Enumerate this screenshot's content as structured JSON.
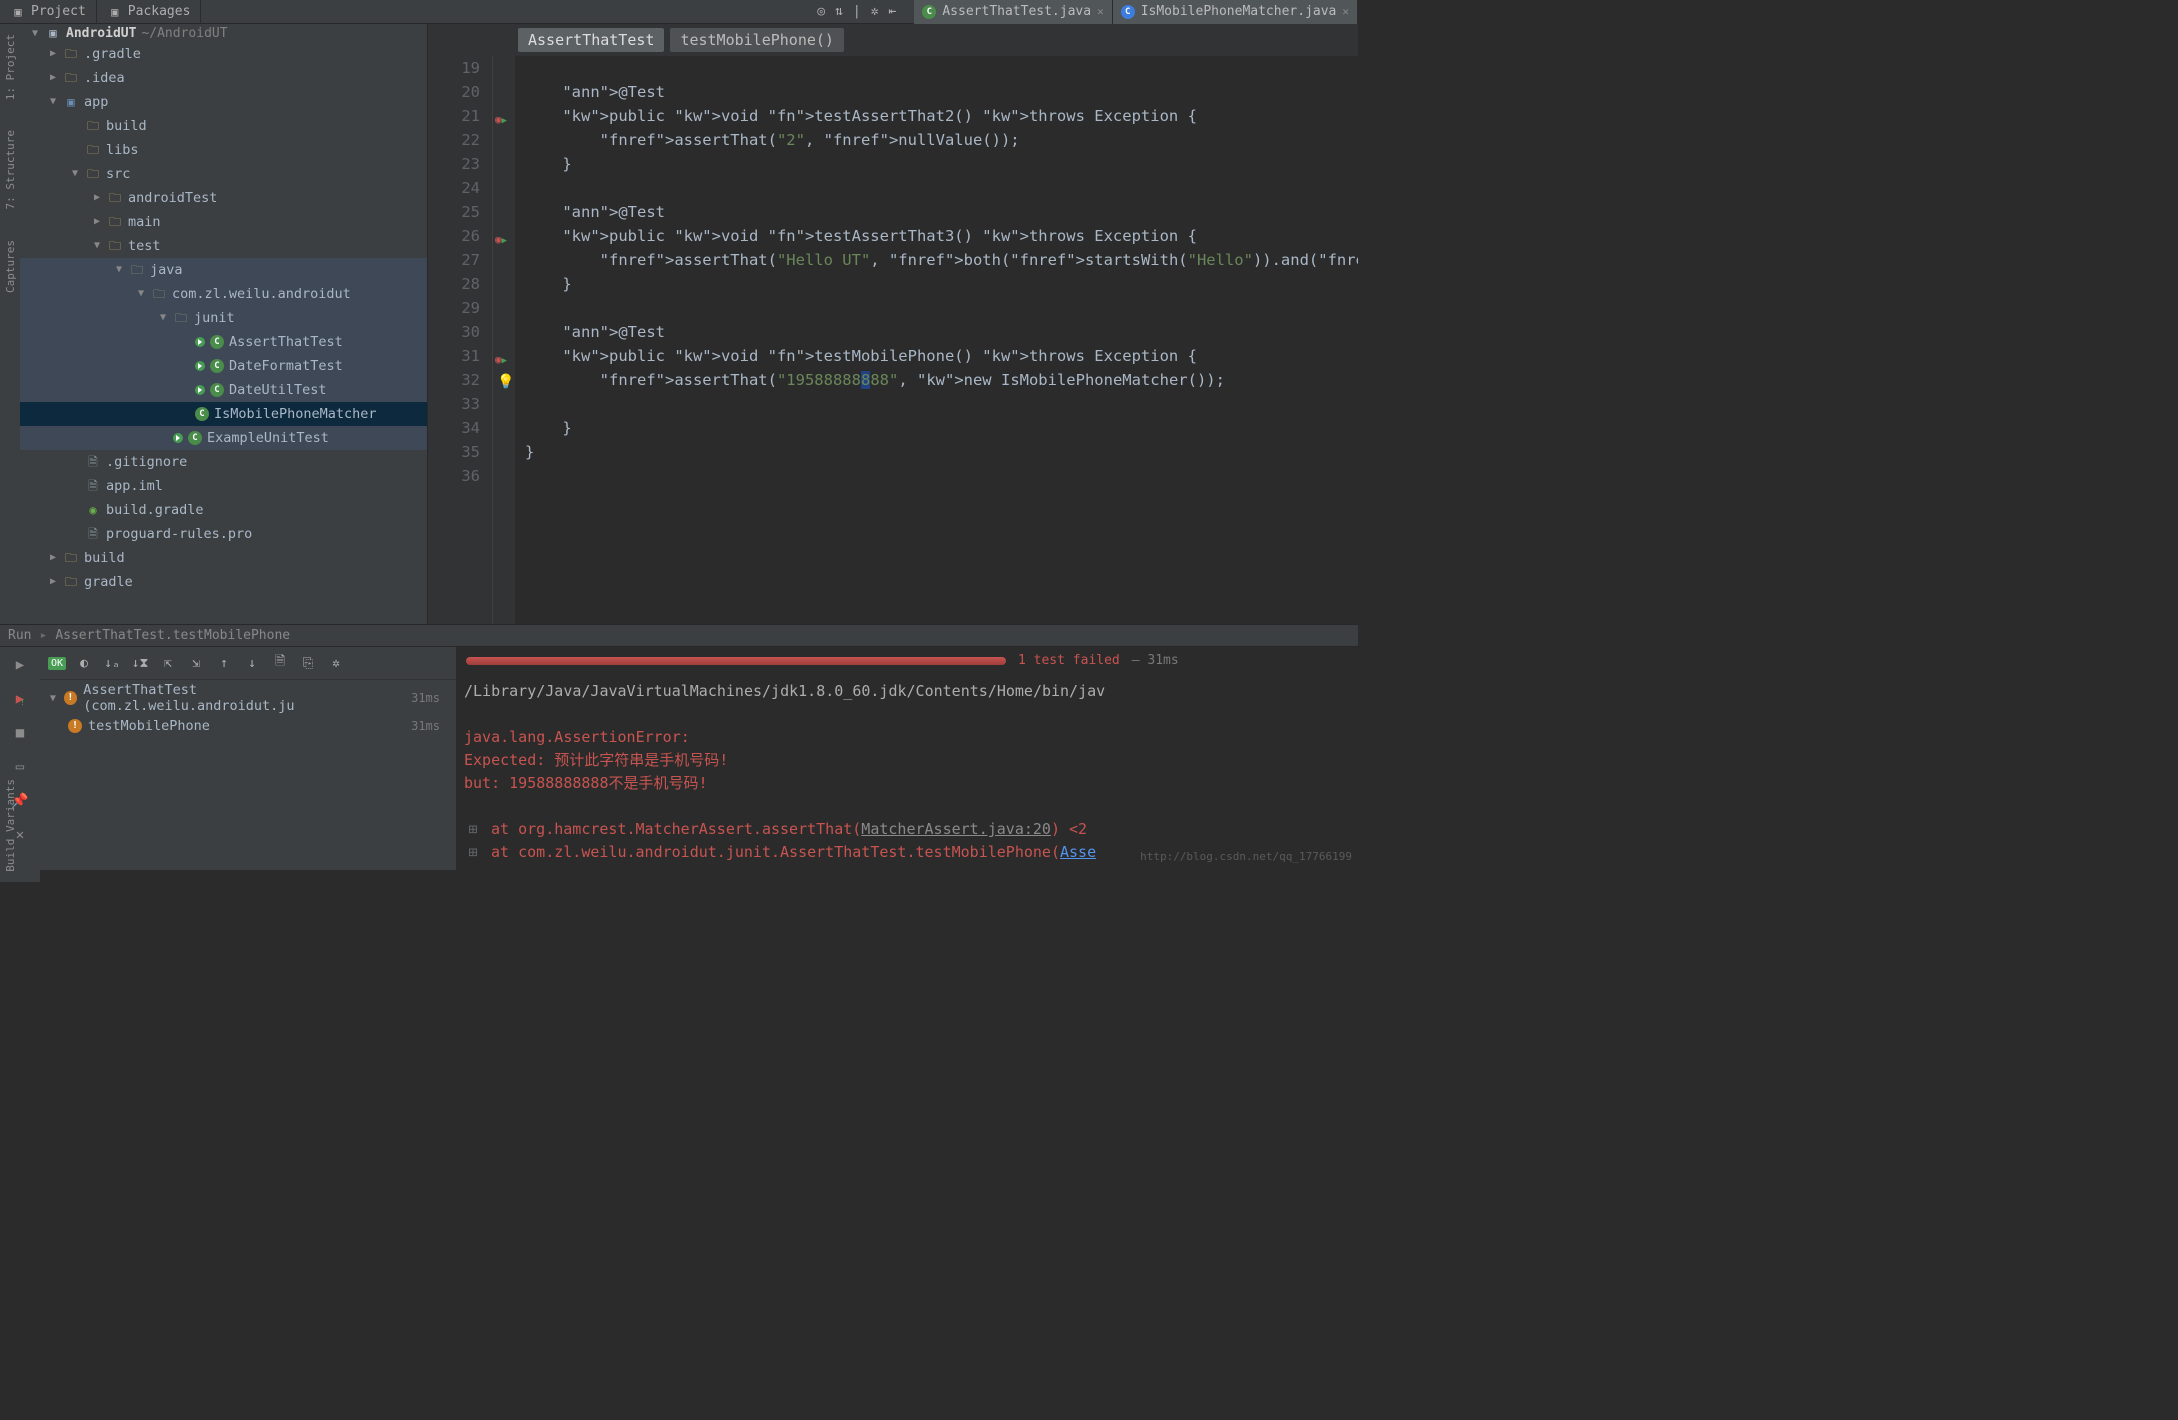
{
  "topbar": {
    "tabs": [
      "Project",
      "Packages"
    ],
    "editorTabs": [
      {
        "name": "AssertThatTest.java"
      },
      {
        "name": "IsMobilePhoneMatcher.java"
      }
    ]
  },
  "leftRail": [
    "1: Project",
    "7: Structure",
    "Captures"
  ],
  "bottomRail": "Build Variants",
  "project": {
    "root": {
      "name": "AndroidUT",
      "path": "~/AndroidUT"
    },
    "tree": [
      {
        "depth": 0,
        "tw": "▶",
        "type": "folder",
        "name": ".gradle"
      },
      {
        "depth": 0,
        "tw": "▶",
        "type": "folder",
        "name": ".idea"
      },
      {
        "depth": 0,
        "tw": "▼",
        "type": "mod",
        "name": "app"
      },
      {
        "depth": 1,
        "tw": "",
        "type": "folder",
        "name": "build"
      },
      {
        "depth": 1,
        "tw": "",
        "type": "folder",
        "name": "libs"
      },
      {
        "depth": 1,
        "tw": "▼",
        "type": "folder",
        "name": "src"
      },
      {
        "depth": 2,
        "tw": "▶",
        "type": "folder",
        "name": "androidTest"
      },
      {
        "depth": 2,
        "tw": "▶",
        "type": "folder",
        "name": "main"
      },
      {
        "depth": 2,
        "tw": "▼",
        "type": "folder",
        "name": "test"
      },
      {
        "depth": 3,
        "tw": "▼",
        "type": "pkg",
        "name": "java",
        "hl": true
      },
      {
        "depth": 4,
        "tw": "▼",
        "type": "pkg",
        "name": "com.zl.weilu.androidut",
        "hl": true
      },
      {
        "depth": 5,
        "tw": "▼",
        "type": "pkg",
        "name": "junit",
        "hl": true
      },
      {
        "depth": 6,
        "tw": "",
        "type": "java",
        "run": true,
        "name": "AssertThatTest",
        "hl": true
      },
      {
        "depth": 6,
        "tw": "",
        "type": "java",
        "run": true,
        "name": "DateFormatTest",
        "hl": true
      },
      {
        "depth": 6,
        "tw": "",
        "type": "java",
        "run": true,
        "name": "DateUtilTest",
        "hl": true
      },
      {
        "depth": 6,
        "tw": "",
        "type": "java",
        "name": "IsMobilePhoneMatcher",
        "sel": true
      },
      {
        "depth": 5,
        "tw": "",
        "type": "java",
        "run": true,
        "name": "ExampleUnitTest",
        "hl": true
      },
      {
        "depth": 1,
        "tw": "",
        "type": "file",
        "name": ".gitignore"
      },
      {
        "depth": 1,
        "tw": "",
        "type": "file",
        "name": "app.iml"
      },
      {
        "depth": 1,
        "tw": "",
        "type": "gradle",
        "name": "build.gradle"
      },
      {
        "depth": 1,
        "tw": "",
        "type": "file",
        "name": "proguard-rules.pro"
      },
      {
        "depth": 0,
        "tw": "▶",
        "type": "folder",
        "name": "build"
      },
      {
        "depth": 0,
        "tw": "▶",
        "type": "folder",
        "name": "gradle"
      }
    ]
  },
  "breadcrumbs": [
    "AssertThatTest",
    "testMobilePhone()"
  ],
  "code": {
    "startLine": 19,
    "lines": [
      "",
      "    @Test",
      "    public void testAssertThat2() throws Exception {",
      "        assertThat(\"2\", nullValue());",
      "    }",
      "",
      "    @Test",
      "    public void testAssertThat3() throws Exception {",
      "        assertThat(\"Hello UT\", both(startsWith(\"Hello\")).and(endsWit",
      "    }",
      "",
      "    @Test",
      "    public void testMobilePhone() throws Exception {",
      "        assertThat(\"19588888888\", new IsMobilePhoneMatcher());",
      "",
      "    }",
      "}",
      ""
    ]
  },
  "run": {
    "label": "Run",
    "config": "AssertThatTest.testMobilePhone",
    "status": "1 test failed",
    "duration": "31ms",
    "tests": [
      {
        "name": "AssertThatTest (com.zl.weilu.androidut.ju",
        "time": "31ms",
        "icon": "warn"
      },
      {
        "name": "testMobilePhone",
        "time": "31ms",
        "icon": "warn",
        "depth": 1
      }
    ],
    "console": {
      "cmd": "/Library/Java/JavaVirtualMachines/jdk1.8.0_60.jdk/Contents/Home/bin/jav",
      "err1": "java.lang.AssertionError:",
      "err2": "Expected: 预计此字符串是手机号码!",
      "err3": "     but: 19588888888不是手机号码!",
      "stack1a": "at org.hamcrest.MatcherAssert.assertThat(",
      "stack1b": "MatcherAssert.java:20",
      "stack1c": ") <2",
      "stack2a": "at com.zl.weilu.androidut.junit.AssertThatTest.testMobilePhone(",
      "stack2b": "Asse"
    }
  },
  "watermark": "http://blog.csdn.net/qq_17766199"
}
